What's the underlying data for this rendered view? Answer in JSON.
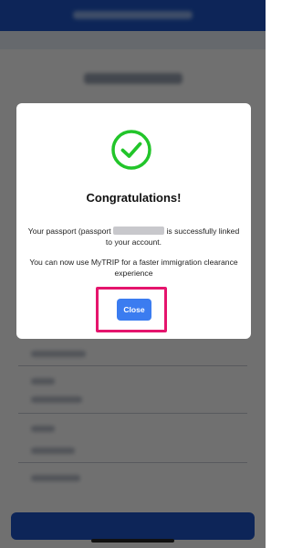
{
  "modal": {
    "title": "Congratulations!",
    "message_prefix": "Your passport (passport",
    "message_suffix": "is successfully linked to your account.",
    "message_secondary": "You can now use MyTRIP for a faster immigration clearance experience",
    "close_label": "Close",
    "success_icon": "check-circle-icon"
  },
  "colors": {
    "brand_blue": "#1e56c8",
    "success_green": "#22c52a",
    "button_blue": "#3b7cf0",
    "highlight_pink": "#e5156d"
  }
}
